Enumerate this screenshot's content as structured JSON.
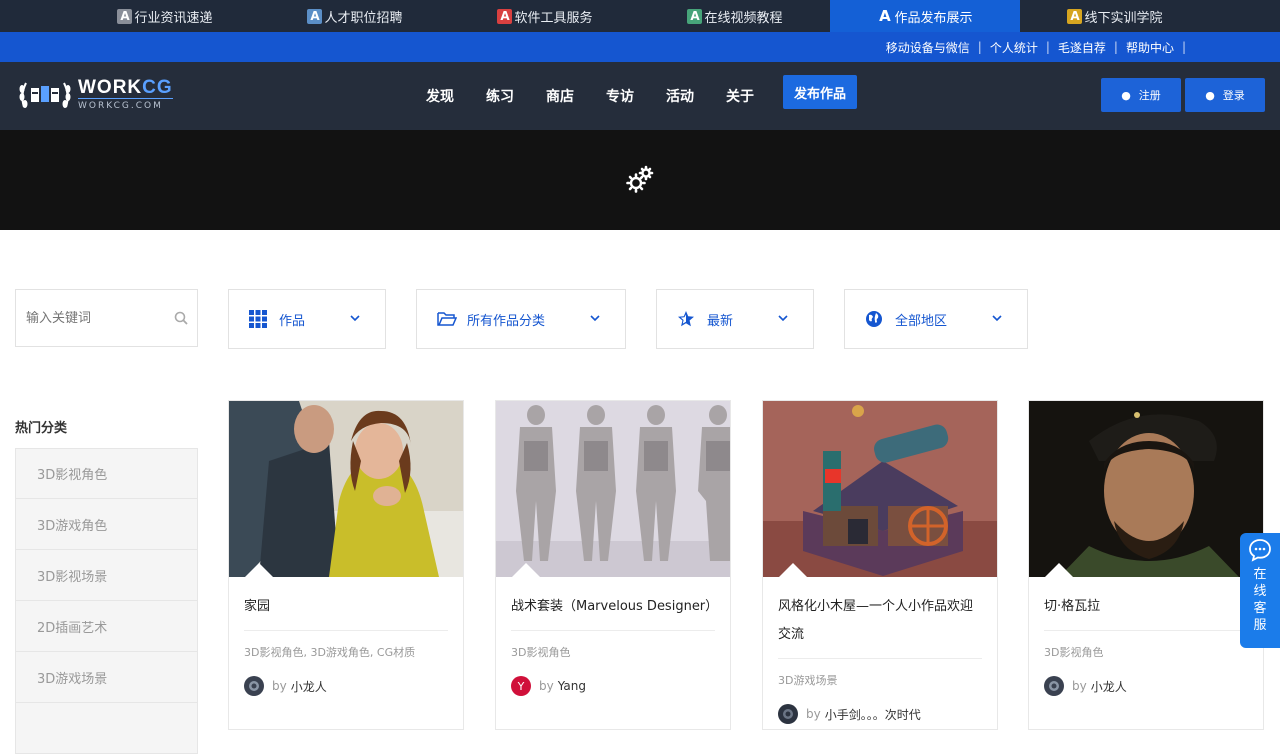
{
  "topstrip": {
    "tabs": [
      {
        "badge": "A",
        "label": "行业资讯速递",
        "color": "#8a8f99"
      },
      {
        "badge": "A",
        "label": "人才职位招聘",
        "color": "#5b8fc7"
      },
      {
        "badge": "A",
        "label": "软件工具服务",
        "color": "#d94040"
      },
      {
        "badge": "A",
        "label": "在线视频教程",
        "color": "#47a47a"
      },
      {
        "badge": "A",
        "label": "作品发布展示",
        "color": "#1460d6"
      },
      {
        "badge": "A",
        "label": "线下实训学院",
        "color": "#d6a520"
      }
    ]
  },
  "utilbar": {
    "links": [
      "移动设备与微信",
      "个人统计",
      "毛遂自荐",
      "帮助中心"
    ],
    "separator": "|"
  },
  "header": {
    "logo": {
      "brand_main": "WORK",
      "brand_accent": "CG",
      "domain": "WORKCG.COM"
    },
    "nav": [
      "发现",
      "练习",
      "商店",
      "专访",
      "活动",
      "关于"
    ],
    "publish_label": "发布作品",
    "register_label": "注册",
    "login_label": "登录"
  },
  "filters": {
    "search_placeholder": "输入关键词",
    "type_label": "作品",
    "category_label": "所有作品分类",
    "sort_label": "最新",
    "region_label": "全部地区"
  },
  "sidebar": {
    "title": "热门分类",
    "categories": [
      "3D影视角色",
      "3D游戏角色",
      "3D影视场景",
      "2D插画艺术",
      "3D游戏场景"
    ]
  },
  "works": [
    {
      "title": "家园",
      "tags": "3D影视角色, 3D游戏角色, CG材质",
      "by": "by",
      "author": "小龙人",
      "avatar_color": "#3a4150"
    },
    {
      "title": "战术套装（Marvelous Designer）",
      "tags": "3D影视角色",
      "by": "by",
      "author": "Yang",
      "avatar_color": "#d0103a",
      "avatar_letter": "Y"
    },
    {
      "title": "风格化小木屋—一个人小作品欢迎交流",
      "tags": "3D游戏场景",
      "by": "by",
      "author": "小手剑。。。次时代",
      "avatar_color": "#2c3340"
    },
    {
      "title": "切·格瓦拉",
      "tags": "3D影视角色",
      "by": "by",
      "author": "小龙人",
      "avatar_color": "#3a4150"
    }
  ],
  "service": {
    "label": "在线客服"
  },
  "colors": {
    "primary": "#1556d0",
    "dark_nav": "#252d3b",
    "banner": "#121212"
  }
}
